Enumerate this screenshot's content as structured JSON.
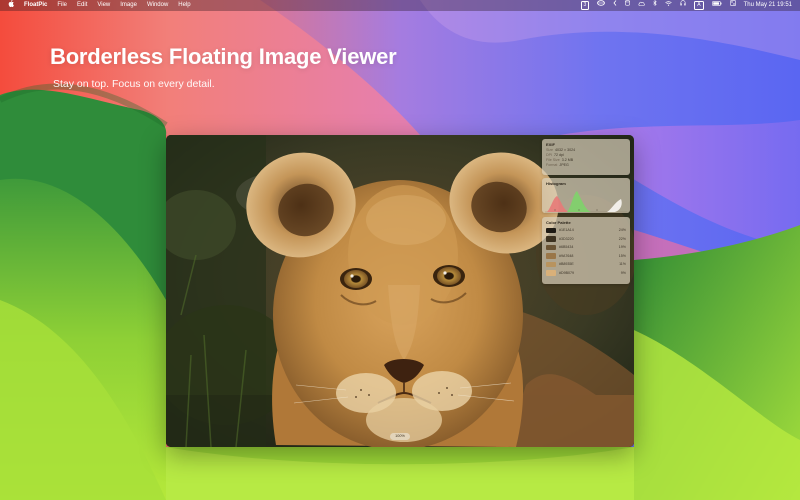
{
  "menubar": {
    "apple_icon": "apple-logo",
    "app_name": "FloatPic",
    "menus": [
      "File",
      "Edit",
      "View",
      "Image",
      "Window",
      "Help"
    ],
    "tray": {
      "screens_badge": "3",
      "keyboard_indicator": "A",
      "datetime": "Thu May 21  19:51"
    }
  },
  "hero": {
    "title": "Borderless Floating Image Viewer",
    "subtitle": "Stay on top. Focus on every detail."
  },
  "viewer": {
    "photo_subject": "lion cub portrait",
    "zoom_label": "100%"
  },
  "exif": {
    "title": "EXIF",
    "rows": [
      {
        "label": "Size",
        "value": "4032 × 3024"
      },
      {
        "label": "DPI",
        "value": "72 dpi"
      },
      {
        "label": "File Size",
        "value": "3.2 MB"
      },
      {
        "label": "Format",
        "value": "JPEG"
      }
    ]
  },
  "histogram": {
    "title": "Histogram",
    "channels": [
      "red",
      "green",
      "blue"
    ],
    "colors": {
      "red": "#e87a78",
      "green": "#7ed36a",
      "blue": "#f4f2ee"
    }
  },
  "palette": {
    "title": "Color Palette",
    "swatches": [
      {
        "hex": "#1E1A14",
        "pct": "24%",
        "color": "#1e1a14"
      },
      {
        "hex": "#3D3220",
        "pct": "22%",
        "color": "#3d3220"
      },
      {
        "hex": "#6B5434",
        "pct": "19%",
        "color": "#6b5434"
      },
      {
        "hex": "#9A7648",
        "pct": "15%",
        "color": "#9a7648"
      },
      {
        "hex": "#B8935E",
        "pct": "11%",
        "color": "#b8935e"
      },
      {
        "hex": "#D9B079",
        "pct": "9%",
        "color": "#d9b079"
      }
    ]
  }
}
